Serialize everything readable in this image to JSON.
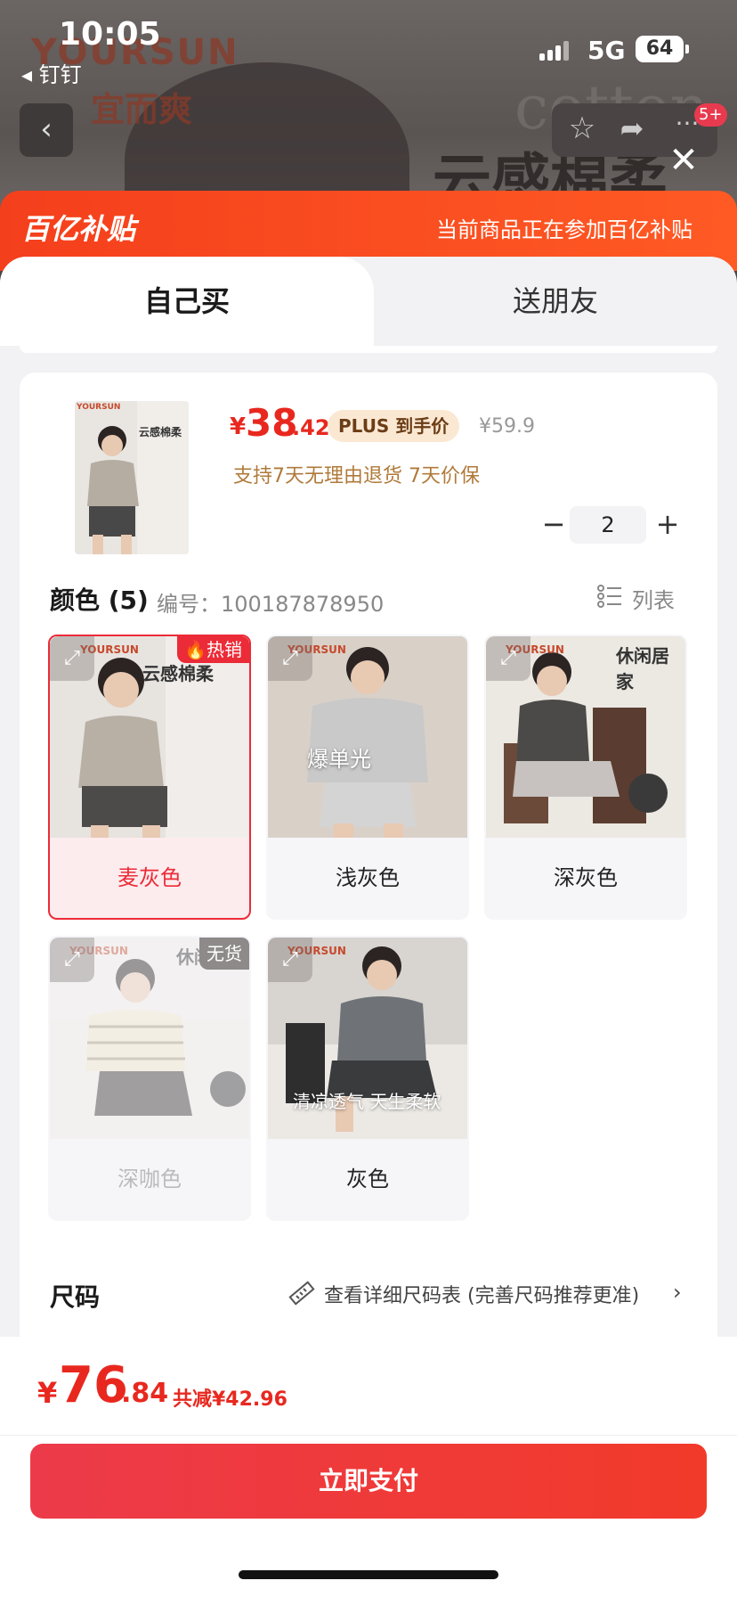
{
  "status_bar": {
    "time": "10:05",
    "back_app": "◂ 钉钉",
    "network": "5G",
    "battery": "64"
  },
  "backdrop": {
    "brand_en": "YOURSUN",
    "brand_cn": "宜而爽",
    "cotton": "cotton",
    "slogan": "云感棉柔"
  },
  "nav": {
    "message_count": "5+"
  },
  "subsidy": {
    "logo": "百亿补贴",
    "note": "当前商品正在参加百亿补贴"
  },
  "tabs": {
    "self": "自己买",
    "friend": "送朋友"
  },
  "product": {
    "price_symbol": "¥",
    "price_int": "38",
    "price_dec": ".42",
    "plus_label": "PLUS 到手价",
    "original_price": "¥59.9",
    "guarantee": "支持7天无理由退货  7天价保",
    "quantity": "2",
    "thumb_brand": "YOURSUN",
    "thumb_slogan": "云感棉柔"
  },
  "colors": {
    "title": "颜色 (5)",
    "sku_label": "编号：100187878950",
    "list_label": "列表",
    "items": [
      {
        "label": "麦灰色",
        "badge": "热销",
        "overlay": "云感棉柔",
        "brand": "YOURSUN"
      },
      {
        "label": "浅灰色",
        "overlay": "爆单光",
        "brand": "YOURSUN"
      },
      {
        "label": "深灰色",
        "overlay": "休闲居家",
        "brand": "YOURSUN"
      },
      {
        "label": "深咖色",
        "badge": "无货",
        "overlay": "休闲居家",
        "brand": "YOURSUN"
      },
      {
        "label": "灰色",
        "overlay": "清凉透气 天生柔软",
        "brand": "YOURSUN"
      }
    ]
  },
  "size": {
    "title": "尺码",
    "chart_link": "查看详细尺码表 (完善尺码推荐更准)"
  },
  "bottom": {
    "total_symbol": "¥",
    "total_int": "76",
    "total_dec": ".84",
    "discount": "共减¥42.96",
    "pay_label": "立即支付"
  }
}
